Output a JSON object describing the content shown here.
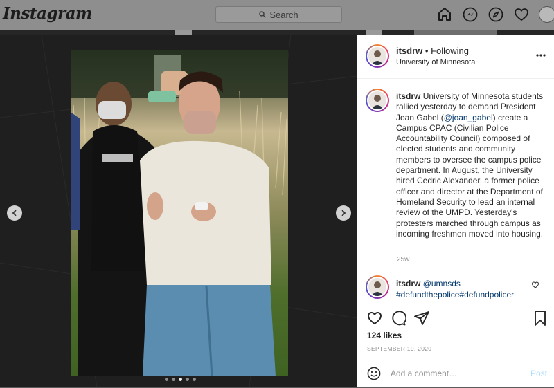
{
  "app": {
    "logo": "Instagram"
  },
  "search": {
    "placeholder": "Search"
  },
  "nav_icons": [
    "home-icon",
    "messenger-icon",
    "explore-icon",
    "heart-icon",
    "profile-avatar"
  ],
  "post": {
    "username": "itsdrw",
    "follow_status": "• Following",
    "location": "University of Minnesota",
    "carousel": {
      "total": 5,
      "active_index": 3
    },
    "caption": {
      "username": "itsdrw",
      "text_before_mention": "University of Minnesota students rallied yesterday to demand President Joan Gabel (",
      "mention": "@joan_gabel",
      "text_after_mention": ") create a Campus CPAC (Civilian Police Accountability Council) composed of elected students and community members to oversee the campus police department. In August, the University hired Cedric Alexander, a former police officer and director at the Department of Homeland Security to lead an internal review of the UMPD. Yesterday's protesters marched through campus as incoming freshmen moved into housing.",
      "age": "25w"
    },
    "comment": {
      "username": "itsdrw",
      "mention": "@umnsds",
      "hashtags": "#defundthepolice#defundpolicer"
    },
    "likes": "124 likes",
    "date": "SEPTEMBER 19, 2020",
    "add_comment": {
      "placeholder": "Add a comment…",
      "post_label": "Post"
    }
  },
  "colors": {
    "link": "#00376b",
    "post_button": "#b2dffc",
    "muted": "#8e8e8e"
  }
}
